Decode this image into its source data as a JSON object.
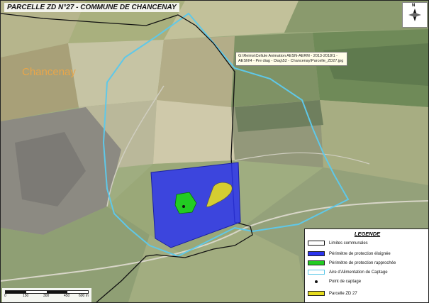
{
  "title": "PARCELLE ZD N°27 - COMMUNE DE CHANCENAY",
  "commune_label": "Chancenay",
  "file_path_label": "G:\\Reims\\Cellule Animation AESN-AERM - 2013-2018\\1 - AESN\\4 - Pre diag - Diag\\52 - Chancenay\\Parcelle_ZD27.jpg",
  "legend": {
    "title": "LEGENDE",
    "items": [
      {
        "label": "Limites communales",
        "symbol": "outline",
        "color": "#111111"
      },
      {
        "label": "Périmètre de protection éloignée",
        "symbol": "fill",
        "color": "#2b34ee"
      },
      {
        "label": "Périmètre de protection rapprochée",
        "symbol": "fill",
        "color": "#22cc22"
      },
      {
        "label": "Aire d'Alimentation de Captage",
        "symbol": "outline",
        "color": "#5fc8e8"
      },
      {
        "label": "Point de captage",
        "symbol": "dot",
        "color": "#111111"
      },
      {
        "label": "Parcelle ZD 27",
        "symbol": "fill",
        "color": "#e6dc1e"
      }
    ]
  },
  "scale_bar": {
    "ticks": [
      "0",
      "150",
      "300",
      "450",
      "600 m"
    ]
  },
  "north_arrow": {
    "label": "N",
    "icon": "north-arrow-icon"
  }
}
